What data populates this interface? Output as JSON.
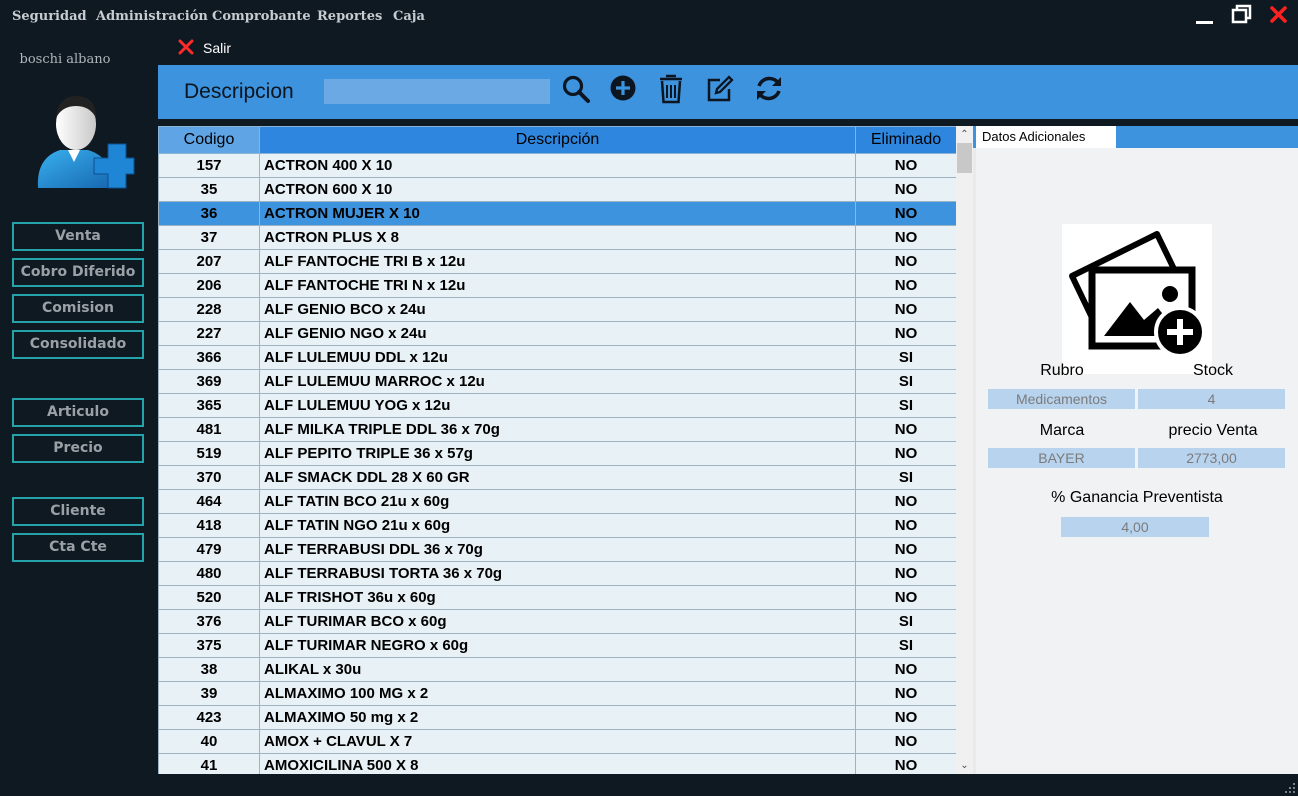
{
  "menu": [
    "Seguridad",
    "Administración",
    "Comprobante",
    "Reportes",
    "Caja"
  ],
  "user": {
    "name": "boschi albano"
  },
  "sidebar": {
    "group1": [
      "Venta",
      "Cobro Diferido",
      "Comision",
      "Consolidado"
    ],
    "group2": [
      "Articulo",
      "Precio"
    ],
    "group3": [
      "Cliente",
      "Cta Cte"
    ]
  },
  "salir_label": "Salir",
  "toolbar": {
    "label": "Descripcion",
    "search_value": "",
    "icons": [
      "search-icon",
      "add-icon",
      "delete-icon",
      "edit-icon",
      "refresh-icon"
    ]
  },
  "grid": {
    "columns": [
      "Codigo",
      "Descripción",
      "Eliminado"
    ],
    "selected_index": 2,
    "rows": [
      [
        "157",
        "ACTRON 400 X 10",
        "NO"
      ],
      [
        "35",
        "ACTRON 600 X 10",
        "NO"
      ],
      [
        "36",
        "ACTRON MUJER X 10",
        "NO"
      ],
      [
        "37",
        "ACTRON PLUS X 8",
        "NO"
      ],
      [
        "207",
        "ALF FANTOCHE TRI B x 12u",
        "NO"
      ],
      [
        "206",
        "ALF FANTOCHE TRI N x 12u",
        "NO"
      ],
      [
        "228",
        "ALF GENIO BCO x 24u",
        "NO"
      ],
      [
        "227",
        "ALF GENIO NGO x 24u",
        "NO"
      ],
      [
        "366",
        "ALF LULEMUU DDL x 12u",
        "SI"
      ],
      [
        "369",
        "ALF LULEMUU MARROC x 12u",
        "SI"
      ],
      [
        "365",
        "ALF LULEMUU YOG x 12u",
        "SI"
      ],
      [
        "481",
        "ALF MILKA TRIPLE DDL 36 x 70g",
        "NO"
      ],
      [
        "519",
        "ALF PEPITO TRIPLE 36 x 57g",
        "NO"
      ],
      [
        "370",
        "ALF SMACK DDL 28 X 60 GR",
        "SI"
      ],
      [
        "464",
        "ALF TATIN BCO 21u x 60g",
        "NO"
      ],
      [
        "418",
        "ALF TATIN NGO 21u x 60g",
        "NO"
      ],
      [
        "479",
        "ALF TERRABUSI DDL 36 x 70g",
        "NO"
      ],
      [
        "480",
        "ALF TERRABUSI TORTA 36 x 70g",
        "NO"
      ],
      [
        "520",
        "ALF TRISHOT 36u x 60g",
        "NO"
      ],
      [
        "376",
        "ALF TURIMAR BCO x 60g",
        "SI"
      ],
      [
        "375",
        "ALF TURIMAR NEGRO x 60g",
        "SI"
      ],
      [
        "38",
        "ALIKAL x 30u",
        "NO"
      ],
      [
        "39",
        "ALMAXIMO 100 MG x 2",
        "NO"
      ],
      [
        "423",
        "ALMAXIMO 50 mg x 2",
        "NO"
      ],
      [
        "40",
        "AMOX + CLAVUL X 7",
        "NO"
      ],
      [
        "41",
        "AMOXICILINA 500 X 8",
        "NO"
      ]
    ]
  },
  "panel": {
    "tab": "Datos Adicionales",
    "rubro_label": "Rubro",
    "rubro_value": "Medicamentos",
    "stock_label": "Stock",
    "stock_value": "4",
    "marca_label": "Marca",
    "marca_value": "BAYER",
    "precio_label": "precio Venta",
    "precio_value": "2773,00",
    "ganancia_label": "% Ganancia Preventista",
    "ganancia_value": "4,00"
  }
}
